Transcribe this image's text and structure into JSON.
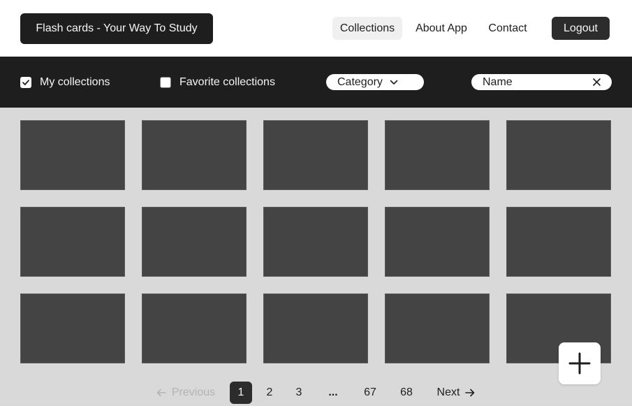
{
  "header": {
    "brand": "Flash cards - Your Way To Study",
    "nav": [
      {
        "label": "Collections",
        "active": true
      },
      {
        "label": "About App",
        "active": false
      },
      {
        "label": "Contact",
        "active": false
      }
    ],
    "logout_label": "Logout"
  },
  "filters": {
    "my_collections": {
      "label": "My collections",
      "checked": true
    },
    "favorite_collections": {
      "label": "Favorite collections",
      "checked": false
    },
    "category_select": {
      "label": "Category",
      "icon": "chevron-down-icon"
    },
    "name_search": {
      "value": "Name",
      "clear_icon": "close-icon"
    }
  },
  "grid": {
    "rows": 3,
    "columns": 5,
    "tile_color": "#444444"
  },
  "fab": {
    "icon": "plus-icon"
  },
  "pagination": {
    "previous_label": "Previous",
    "next_label": "Next",
    "pages": [
      "1",
      "2",
      "3",
      "...",
      "67",
      "68"
    ],
    "current_page": "1"
  },
  "colors": {
    "dark": "#1e1e1e",
    "button": "#2c2c2c",
    "background": "#d9d9d9",
    "header_bg": "#ffffff",
    "muted": "#b3b3b3"
  }
}
